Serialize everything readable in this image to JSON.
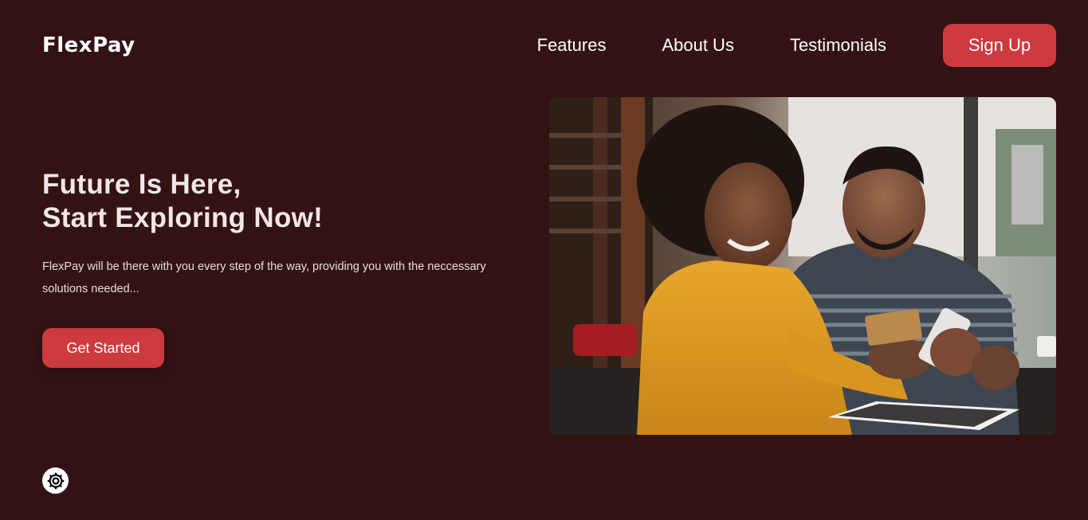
{
  "brand": {
    "name": "FlexPay"
  },
  "nav": {
    "links": [
      "Features",
      "About Us",
      "Testimonials"
    ],
    "signup_label": "Sign Up"
  },
  "hero": {
    "title_line1": "Future Is Here,",
    "title_line2": "Start Exploring Now!",
    "description": "FlexPay will be there with you every step of the way, providing you with the neccessary solutions needed...",
    "cta_label": "Get Started",
    "image_icon": "couple-paying-with-card-photo"
  },
  "settings": {
    "icon": "gear-icon"
  },
  "colors": {
    "background": "#331213",
    "accent": "#cc3a3d",
    "text": "#ffffff"
  }
}
